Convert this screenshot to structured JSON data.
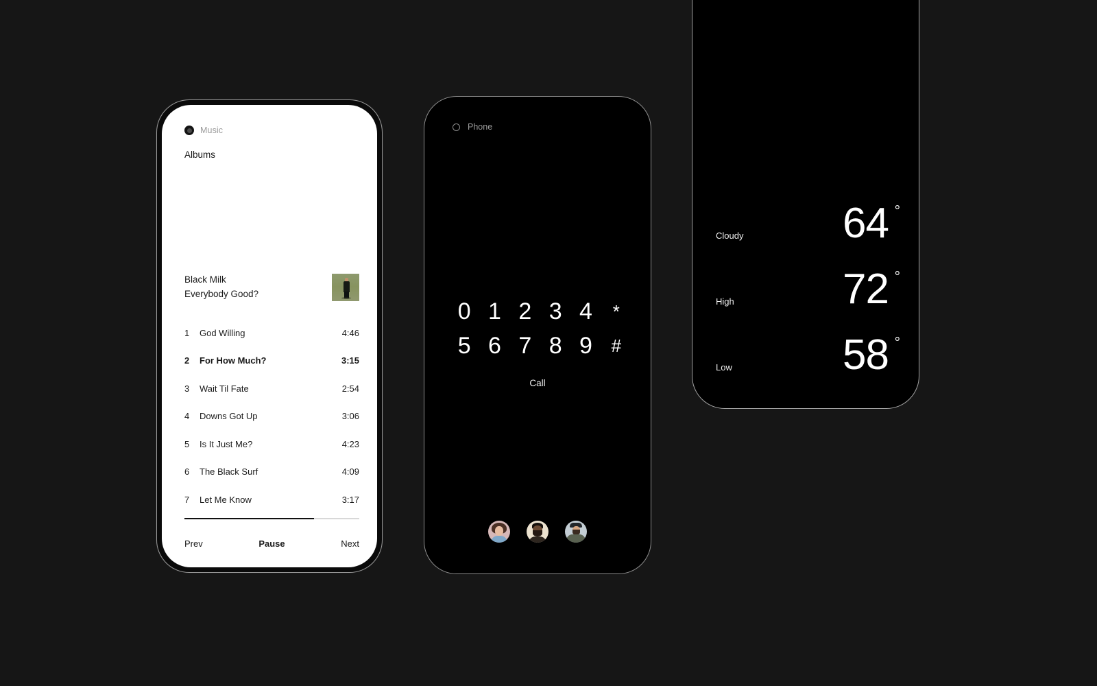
{
  "background_color": "#161616",
  "music_phone": {
    "app_icon": "record-circle-icon",
    "app_name": "Music",
    "section_title": "Albums",
    "album": {
      "artist": "Black Milk",
      "title": "Everybody Good?",
      "art_alt": "album-artwork",
      "art_bg_color": "#8e9a6e"
    },
    "tracks": [
      {
        "num": "1",
        "title": "God Willing",
        "duration": "4:46",
        "active": false
      },
      {
        "num": "2",
        "title": "For How Much?",
        "duration": "3:15",
        "active": true
      },
      {
        "num": "3",
        "title": "Wait Til Fate",
        "duration": "2:54",
        "active": false
      },
      {
        "num": "4",
        "title": "Downs Got Up",
        "duration": "3:06",
        "active": false
      },
      {
        "num": "5",
        "title": "Is It Just Me?",
        "duration": "4:23",
        "active": false
      },
      {
        "num": "6",
        "title": "The Black Surf",
        "duration": "4:09",
        "active": false
      },
      {
        "num": "7",
        "title": "Let Me Know",
        "duration": "3:17",
        "active": false
      }
    ],
    "progress_percent": 74,
    "controls": {
      "prev": "Prev",
      "play_pause": "Pause",
      "next": "Next"
    }
  },
  "dialer_phone": {
    "app_icon": "circle-outline-icon",
    "app_name": "Phone",
    "keys": [
      "0",
      "1",
      "2",
      "3",
      "4",
      "*",
      "5",
      "6",
      "7",
      "8",
      "9",
      "#"
    ],
    "call_label": "Call",
    "contacts": [
      {
        "name": "contact-avatar-1",
        "bg_color": "#d6b8b8"
      },
      {
        "name": "contact-avatar-2",
        "bg_color": "#ece2cf"
      },
      {
        "name": "contact-avatar-3",
        "bg_color": "#c3cdd4"
      }
    ]
  },
  "weather_phone": {
    "rows": [
      {
        "label": "Cloudy",
        "value": "64",
        "degree": "°"
      },
      {
        "label": "High",
        "value": "72",
        "degree": "°"
      },
      {
        "label": "Low",
        "value": "58",
        "degree": "°"
      }
    ]
  }
}
